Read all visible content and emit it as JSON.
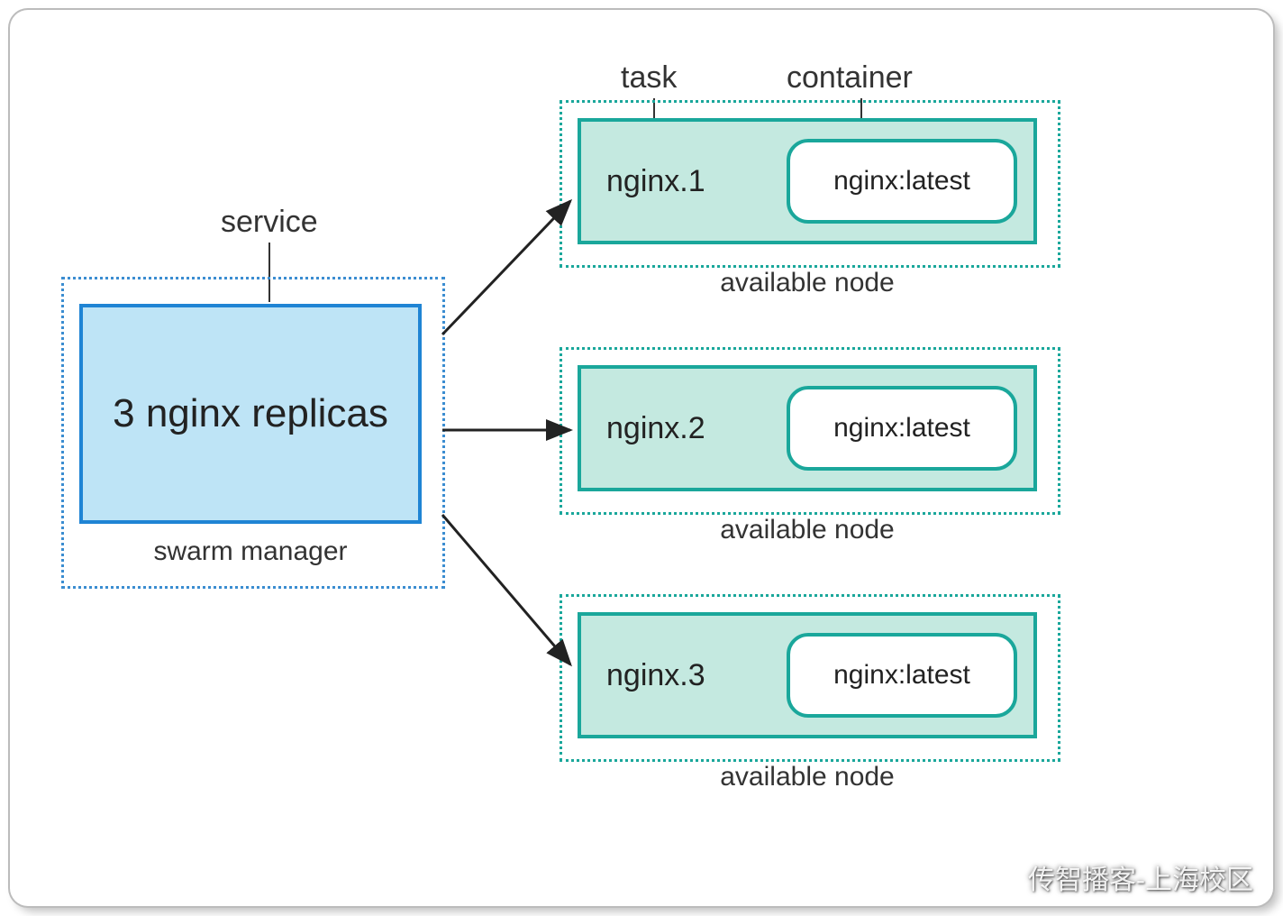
{
  "labels": {
    "service": "service",
    "task": "task",
    "container": "container"
  },
  "swarm": {
    "box_text": "3 nginx replicas",
    "caption": "swarm manager"
  },
  "nodes": [
    {
      "task": "nginx.1",
      "container": "nginx:latest",
      "caption": "available node"
    },
    {
      "task": "nginx.2",
      "container": "nginx:latest",
      "caption": "available node"
    },
    {
      "task": "nginx.3",
      "container": "nginx:latest",
      "caption": "available node"
    }
  ],
  "watermark": "传智播客-上海校区",
  "colors": {
    "blue_border": "#1f84d4",
    "blue_fill": "#bee4f6",
    "blue_dash": "#3b8dd1",
    "teal_border": "#1aa79b",
    "teal_fill": "#c4e9e0"
  }
}
